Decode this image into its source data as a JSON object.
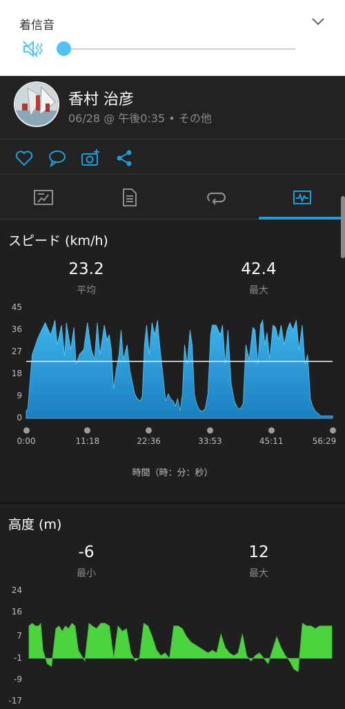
{
  "volume_panel": {
    "title": "着信音",
    "level": 0.0
  },
  "activity": {
    "user_name": "香村 治彦",
    "meta": "06/28 @ 午後0:35 • その他"
  },
  "actions": [
    "heart-icon",
    "comment-icon",
    "add-photo-icon",
    "share-icon"
  ],
  "tabs": [
    "summary-icon",
    "details-icon",
    "laps-icon",
    "charts-icon"
  ],
  "colors": {
    "accent": "#1e9fdc",
    "speed_fill": "#2a9fd8",
    "elevation_fill": "#4cd43f",
    "background": "#1f1f1f"
  },
  "speed_section": {
    "title": "スピード (km/h)",
    "avg_value": "23.2",
    "avg_label": "平均",
    "max_value": "42.4",
    "max_label": "最大",
    "x_caption": "時間（時：分：秒）"
  },
  "elevation_section": {
    "title": "高度 (m)",
    "min_value": "-6",
    "min_label": "最小",
    "max_value": "12",
    "max_label": "最大"
  },
  "chart_data": [
    {
      "type": "area",
      "xlabel": "時間（時：分：秒）",
      "ylabel": "スピード (km/h)",
      "ylim": [
        0,
        45
      ],
      "y_ticks": [
        "0",
        "9",
        "18",
        "27",
        "36",
        "45"
      ],
      "x_ticks": [
        "0:00",
        "11:18",
        "22:36",
        "33:53",
        "45:11",
        "56:29"
      ],
      "average_line": 23.2,
      "x_minutes": [
        0,
        0.3,
        1.1,
        2.2,
        3.5,
        4.5,
        5.3,
        5.7,
        6.5,
        7.1,
        7.4,
        8.2,
        8.8,
        9.2,
        9.8,
        10.6,
        11.3,
        12,
        12.6,
        13.1,
        13.6,
        14.4,
        14.9,
        15.3,
        15.7,
        16.1,
        16.6,
        17.1,
        17.5,
        17.9,
        18.6,
        19.1,
        20,
        20.5,
        21,
        21.4,
        21.8,
        22.2,
        22.7,
        23.2,
        23.7,
        24.2,
        24.7,
        25.2,
        25.7,
        26.2,
        26.6,
        27.1,
        27.5,
        27.9,
        28.4,
        28.8,
        29.2,
        29.7,
        30.2,
        30.6,
        31,
        31.4,
        31.8,
        32.2,
        32.6,
        33,
        33.5,
        34,
        34.3,
        35,
        35.8,
        36.2,
        36.7,
        37.2,
        37.8,
        38.4,
        38.8,
        39.1,
        39.5,
        40,
        40.5,
        41.1,
        41.8,
        42.2,
        42.7,
        43.2,
        43.6,
        44,
        44.4,
        44.9,
        45.5,
        46,
        46.5,
        47,
        47.6,
        48.1,
        48.6,
        49.2,
        49.8,
        50.3,
        50.9,
        51.4,
        51.9,
        52.4,
        52.8,
        53.3,
        53.8,
        54.3,
        54.9,
        55.3,
        55.8,
        56.2,
        56.49
      ],
      "values": [
        3,
        4,
        26,
        33,
        39,
        34,
        40,
        30,
        38,
        25,
        39,
        28,
        37,
        22,
        26,
        28,
        39,
        28,
        24,
        39,
        26,
        38,
        32,
        34,
        28,
        12,
        20,
        26,
        36,
        24,
        30,
        20,
        10,
        8,
        7,
        9,
        30,
        38,
        26,
        39,
        34,
        40,
        28,
        18,
        7,
        10,
        8,
        7,
        5,
        8,
        3,
        10,
        30,
        22,
        36,
        30,
        10,
        6,
        4,
        3,
        3,
        4,
        10,
        34,
        38,
        38,
        34,
        38,
        22,
        36,
        14,
        7,
        5,
        4,
        4,
        6,
        30,
        24,
        37,
        36,
        22,
        38,
        40,
        30,
        35,
        24,
        38,
        37,
        32,
        38,
        30,
        36,
        39,
        36,
        40,
        28,
        38,
        22,
        26,
        8,
        5,
        3,
        2,
        1,
        1,
        1,
        1,
        1,
        1
      ]
    },
    {
      "type": "area",
      "ylabel": "高度 (m)",
      "ylim": [
        -17,
        24
      ],
      "y_ticks": [
        "-17",
        "-9",
        "-1",
        "7",
        "16",
        "24"
      ],
      "x_minutes": [
        0,
        0.6,
        1.2,
        1.8,
        2.2,
        2.6,
        3.4,
        4.2,
        5,
        5.6,
        6.2,
        6.8,
        7.4,
        8,
        8.6,
        9.2,
        9.8,
        10.4,
        11.2,
        11.8,
        12.6,
        13.4,
        14.2,
        15,
        15.8,
        16.6,
        17.4,
        18.2,
        19,
        19.8,
        20.6,
        21.4,
        22.2,
        23,
        23.8,
        24.6,
        25.4,
        26.2,
        27,
        27.8,
        28.6,
        29.4,
        30.2,
        31,
        31.8,
        32.6,
        33.4,
        34.2,
        35,
        35.8,
        36.6,
        37.4,
        38.2,
        39,
        39.8,
        40.6,
        41.4,
        42.2,
        43,
        43.8,
        44.6,
        45.4,
        46.2,
        47,
        47.8,
        48.6,
        49.4,
        50.2,
        51,
        51.8,
        52.6,
        53.4,
        54.2,
        55,
        55.8,
        56.49
      ],
      "values": [
        11,
        12,
        11,
        11,
        12,
        2,
        -3,
        -4,
        10,
        11,
        9,
        11,
        10,
        12,
        11,
        2,
        0,
        -2,
        12,
        11,
        10,
        12,
        12,
        11,
        -1,
        11,
        9,
        10,
        1,
        -2,
        -1,
        12,
        11,
        7,
        2,
        0,
        1,
        -1,
        11,
        11,
        10,
        7,
        5,
        4,
        3,
        2,
        1,
        2,
        1,
        8,
        3,
        1,
        0,
        1,
        8,
        0,
        -2,
        0,
        1,
        -1,
        -3,
        2,
        7,
        3,
        0,
        -2,
        -5,
        -6,
        12,
        11,
        11,
        10,
        11,
        11,
        11,
        11
      ]
    }
  ]
}
